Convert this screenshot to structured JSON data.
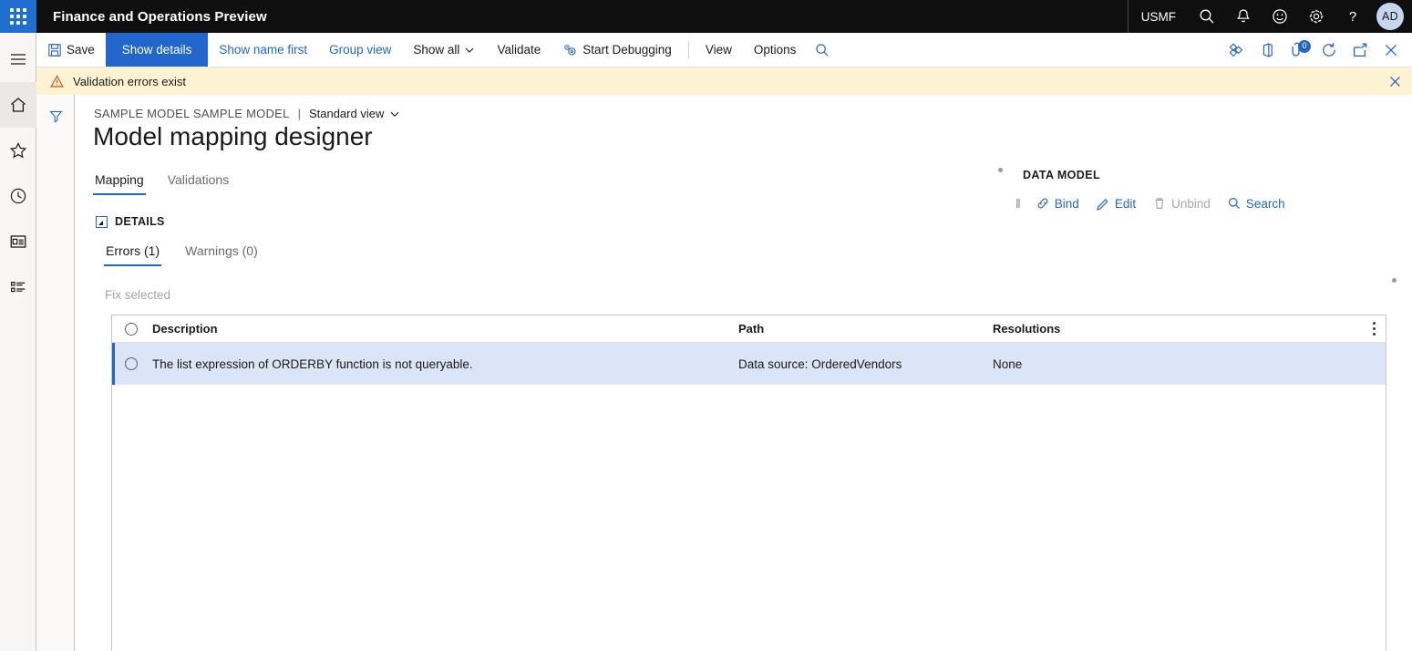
{
  "header": {
    "waffle_icon": "waffle-grid-icon",
    "app_title": "Finance and Operations Preview",
    "company": "USMF",
    "icons": [
      {
        "name": "search-icon",
        "label": "Search"
      },
      {
        "name": "notifications-bell-icon",
        "label": "Notifications"
      },
      {
        "name": "feedback-smiley-icon",
        "label": "Feedback"
      },
      {
        "name": "settings-gear-icon",
        "label": "Settings"
      },
      {
        "name": "help-question-icon",
        "label": "Help"
      }
    ],
    "avatar_initials": "AD"
  },
  "navrail": {
    "items": [
      {
        "name": "hamburger-menu-icon",
        "label": "Expand the navigation pane"
      },
      {
        "name": "home-icon",
        "label": "Home",
        "active": true
      },
      {
        "name": "favorites-star-icon",
        "label": "Favorites"
      },
      {
        "name": "recent-clock-icon",
        "label": "Recent"
      },
      {
        "name": "workspaces-icon",
        "label": "Workspaces"
      },
      {
        "name": "modules-list-icon",
        "label": "Modules"
      }
    ]
  },
  "toolbar": {
    "save_label": "Save",
    "show_details_label": "Show details",
    "show_name_first_label": "Show name first",
    "group_view_label": "Group view",
    "show_all_label": "Show all",
    "validate_label": "Validate",
    "start_debugging_label": "Start Debugging",
    "view_label": "View",
    "options_label": "Options",
    "search_icon": "search-icon",
    "right_icons": [
      {
        "name": "share-diamond-icon",
        "label": "Share"
      },
      {
        "name": "office-app-icon",
        "label": "Open in Microsoft Office"
      },
      {
        "name": "attachments-pin-icon",
        "label": "Attachments",
        "badge": "0"
      },
      {
        "name": "refresh-icon",
        "label": "Refresh"
      },
      {
        "name": "open-in-new-window-icon",
        "label": "Open in new window"
      },
      {
        "name": "close-icon",
        "label": "Close"
      }
    ]
  },
  "messagebar": {
    "warning_icon": "warning-triangle-icon",
    "text": "Validation errors exist",
    "close_icon": "close-icon"
  },
  "filter_column": {
    "funnel_icon": "filter-funnel-icon"
  },
  "breadcrumb": {
    "model": "SAMPLE MODEL SAMPLE MODEL",
    "separator": "|",
    "view": "Standard view",
    "chevron_icon": "chevron-down-icon"
  },
  "page": {
    "title": "Model mapping designer",
    "tabs": [
      {
        "label": "Mapping",
        "active": true
      },
      {
        "label": "Validations",
        "active": false
      }
    ]
  },
  "details": {
    "section_label": "DETAILS",
    "collapse_icon": "collapse-caret-icon",
    "subtabs": [
      {
        "label": "Errors (1)",
        "active": true
      },
      {
        "label": "Warnings (0)",
        "active": false
      }
    ],
    "fix_selected_label": "Fix selected"
  },
  "grid": {
    "select_all_icon": "radio-select-all",
    "columns": [
      "Description",
      "Path",
      "Resolutions"
    ],
    "overflow_menu_icon": "vertical-dots-icon",
    "rows": [
      {
        "description": "The list expression of ORDERBY function is not queryable.",
        "path": "Data source: OrderedVendors",
        "resolutions": "None",
        "selected": true
      }
    ]
  },
  "data_model_panel": {
    "title": "DATA MODEL",
    "splitter_handle": "‖",
    "actions": [
      {
        "label": "Bind",
        "icon": "link-chain-icon",
        "disabled": false
      },
      {
        "label": "Edit",
        "icon": "pencil-edit-icon",
        "disabled": false
      },
      {
        "label": "Unbind",
        "icon": "trash-delete-icon",
        "disabled": true
      },
      {
        "label": "Search",
        "icon": "search-icon",
        "disabled": false
      }
    ]
  },
  "colors": {
    "brand_blue": "#2266cc",
    "header_black": "#0f0f0f",
    "warning_bg": "#fdf3d3",
    "row_selected_bg": "#dbe5f7"
  }
}
